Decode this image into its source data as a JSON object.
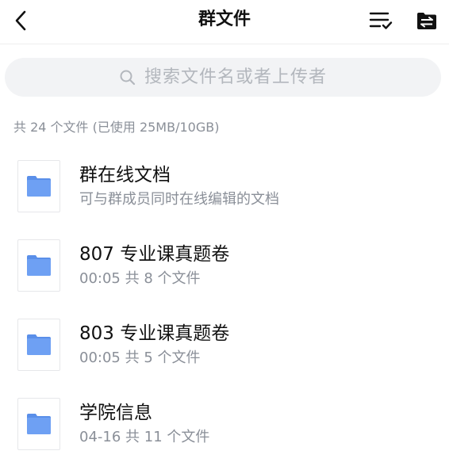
{
  "header": {
    "title": "群文件",
    "icons": {
      "back": "chevron-left-icon",
      "sort": "sort-list-icon",
      "folder": "folder-transfer-icon"
    }
  },
  "search": {
    "placeholder": "搜索文件名或者上传者"
  },
  "summary": {
    "text": "共 24 个文件 (已使用 25MB/10GB)"
  },
  "colors": {
    "folder": "#6ea0f3",
    "folder_tab": "#5a8fe9",
    "search_bg": "#f2f3f5",
    "secondary_text": "#8a8f98"
  },
  "files": [
    {
      "title": "群在线文档",
      "subtitle": "可与群成员同时在线编辑的文档"
    },
    {
      "title": "807 专业课真题卷",
      "subtitle": "00:05 共 8 个文件"
    },
    {
      "title": "803 专业课真题卷",
      "subtitle": "00:05 共 5 个文件"
    },
    {
      "title": "学院信息",
      "subtitle": "04-16 共 11 个文件"
    }
  ]
}
